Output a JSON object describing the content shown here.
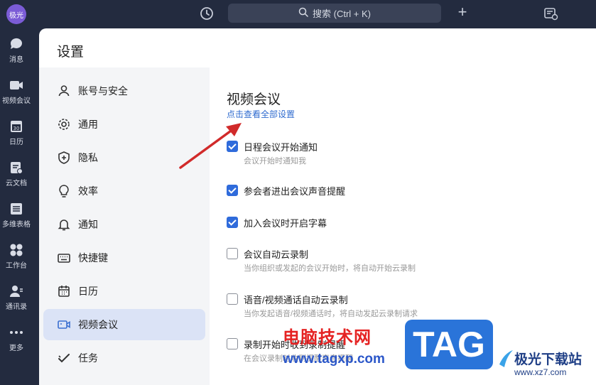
{
  "topbar": {
    "avatar": "极光",
    "search_placeholder": "搜索 (Ctrl + K)"
  },
  "leftnav": {
    "items": [
      {
        "label": "消息",
        "icon": "chat-icon"
      },
      {
        "label": "视频会议",
        "icon": "video-icon"
      },
      {
        "label": "日历",
        "icon": "calendar-icon"
      },
      {
        "label": "云文档",
        "icon": "doc-icon"
      },
      {
        "label": "多维表格",
        "icon": "table-icon"
      },
      {
        "label": "工作台",
        "icon": "grid-icon"
      },
      {
        "label": "通讯录",
        "icon": "contacts-icon"
      },
      {
        "label": "更多",
        "icon": "more-icon"
      }
    ]
  },
  "window": {
    "title": "设置",
    "nav": [
      {
        "label": "账号与安全",
        "icon": "user-icon"
      },
      {
        "label": "通用",
        "icon": "gear-icon"
      },
      {
        "label": "隐私",
        "icon": "shield-icon"
      },
      {
        "label": "效率",
        "icon": "bulb-icon"
      },
      {
        "label": "通知",
        "icon": "bell-icon"
      },
      {
        "label": "快捷键",
        "icon": "keyboard-icon"
      },
      {
        "label": "日历",
        "icon": "calendar-icon"
      },
      {
        "label": "视频会议",
        "icon": "video-icon",
        "active": true
      },
      {
        "label": "任务",
        "icon": "task-icon"
      }
    ]
  },
  "content": {
    "section_title": "视频会议",
    "view_all_link": "点击查看全部设置",
    "options": [
      {
        "label": "日程会议开始通知",
        "desc": "会议开始时通知我",
        "checked": true
      },
      {
        "label": "参会者进出会议声音提醒",
        "desc": "",
        "checked": true
      },
      {
        "label": "加入会议时开启字幕",
        "desc": "",
        "checked": true
      },
      {
        "label": "会议自动云录制",
        "desc": "当你组织或发起的会议开始时，将自动开始云录制",
        "checked": false
      },
      {
        "label": "语音/视频通话自动云录制",
        "desc": "当你发起语音/视频通话时，将自动发起云录制请求",
        "checked": false
      },
      {
        "label": "录制开始时收到录制提醒",
        "desc": "在会议录制时收到提醒声音提醒",
        "checked": false
      }
    ]
  },
  "watermark": {
    "site_name": "电脑技术网",
    "site_url": "www.tagxp.com",
    "tag": "TAG",
    "logo_name": "极光下载站",
    "logo_url": "www.xz7.com"
  },
  "colors": {
    "sidebar_bg": "#232b3f",
    "accent": "#2f6bdb",
    "active_nav_bg": "#dbe3f6",
    "arrow": "#d12a2a"
  }
}
